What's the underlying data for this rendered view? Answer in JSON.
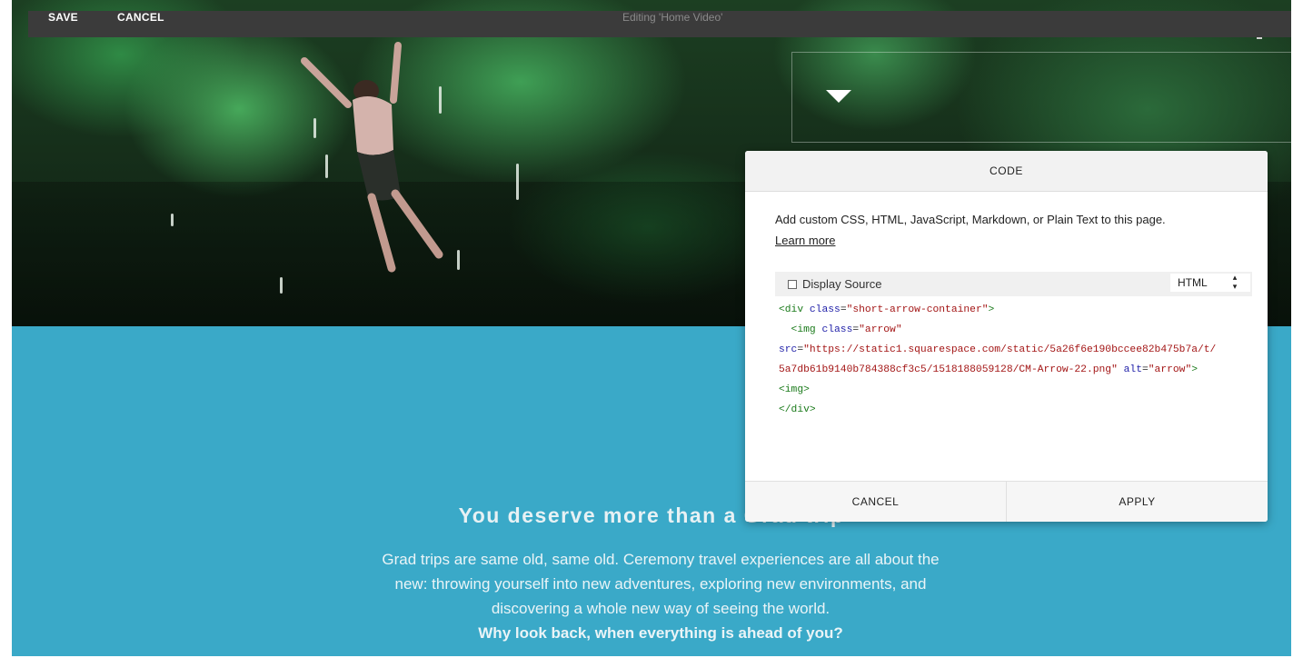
{
  "topbar": {
    "save_label": "SAVE",
    "cancel_label": "CANCEL",
    "editing_title": "Editing 'Home Video'"
  },
  "section": {
    "headline": "You deserve more than a Grad trip",
    "paragraph": "Grad trips are same old, same old. Ceremony travel experiences are all about the new: throwing yourself into new adventures, exploring new environments, and discovering a whole new way of seeing the world.",
    "paragraph_bold": "Why look back, when everything is ahead of you?"
  },
  "dialog": {
    "title": "CODE",
    "description": "Add custom CSS, HTML, JavaScript, Markdown, or Plain Text to this page.",
    "learn_more": "Learn more",
    "display_source_label": "Display Source",
    "mode_selected": "HTML",
    "code_lines": [
      [
        "<div ",
        "class",
        "=",
        "\"short-arrow-container\"",
        ">"
      ],
      [
        "  <img ",
        "class",
        "=",
        "\"arrow\"",
        ""
      ],
      [
        "",
        "src",
        "=",
        "\"https://static1.squarespace.com/static/5a26f6e190bccee82b475b7a/t/",
        ""
      ],
      [
        "",
        "",
        "",
        "5a7db61b9140b784388cf3c5/1518188059128/CM-Arrow-22.png\"",
        " "
      ],
      [
        "<img>",
        "",
        "",
        "",
        ""
      ],
      [
        "</div>",
        "",
        "",
        "",
        ""
      ]
    ],
    "code_line4_alt_attr": "alt",
    "code_line4_alt_val": "\"arrow\"",
    "code_line4_close": ">",
    "cancel_label": "CANCEL",
    "apply_label": "APPLY"
  },
  "colors": {
    "teal": "#3aa9c8",
    "topbar": "#3b3b3b"
  }
}
